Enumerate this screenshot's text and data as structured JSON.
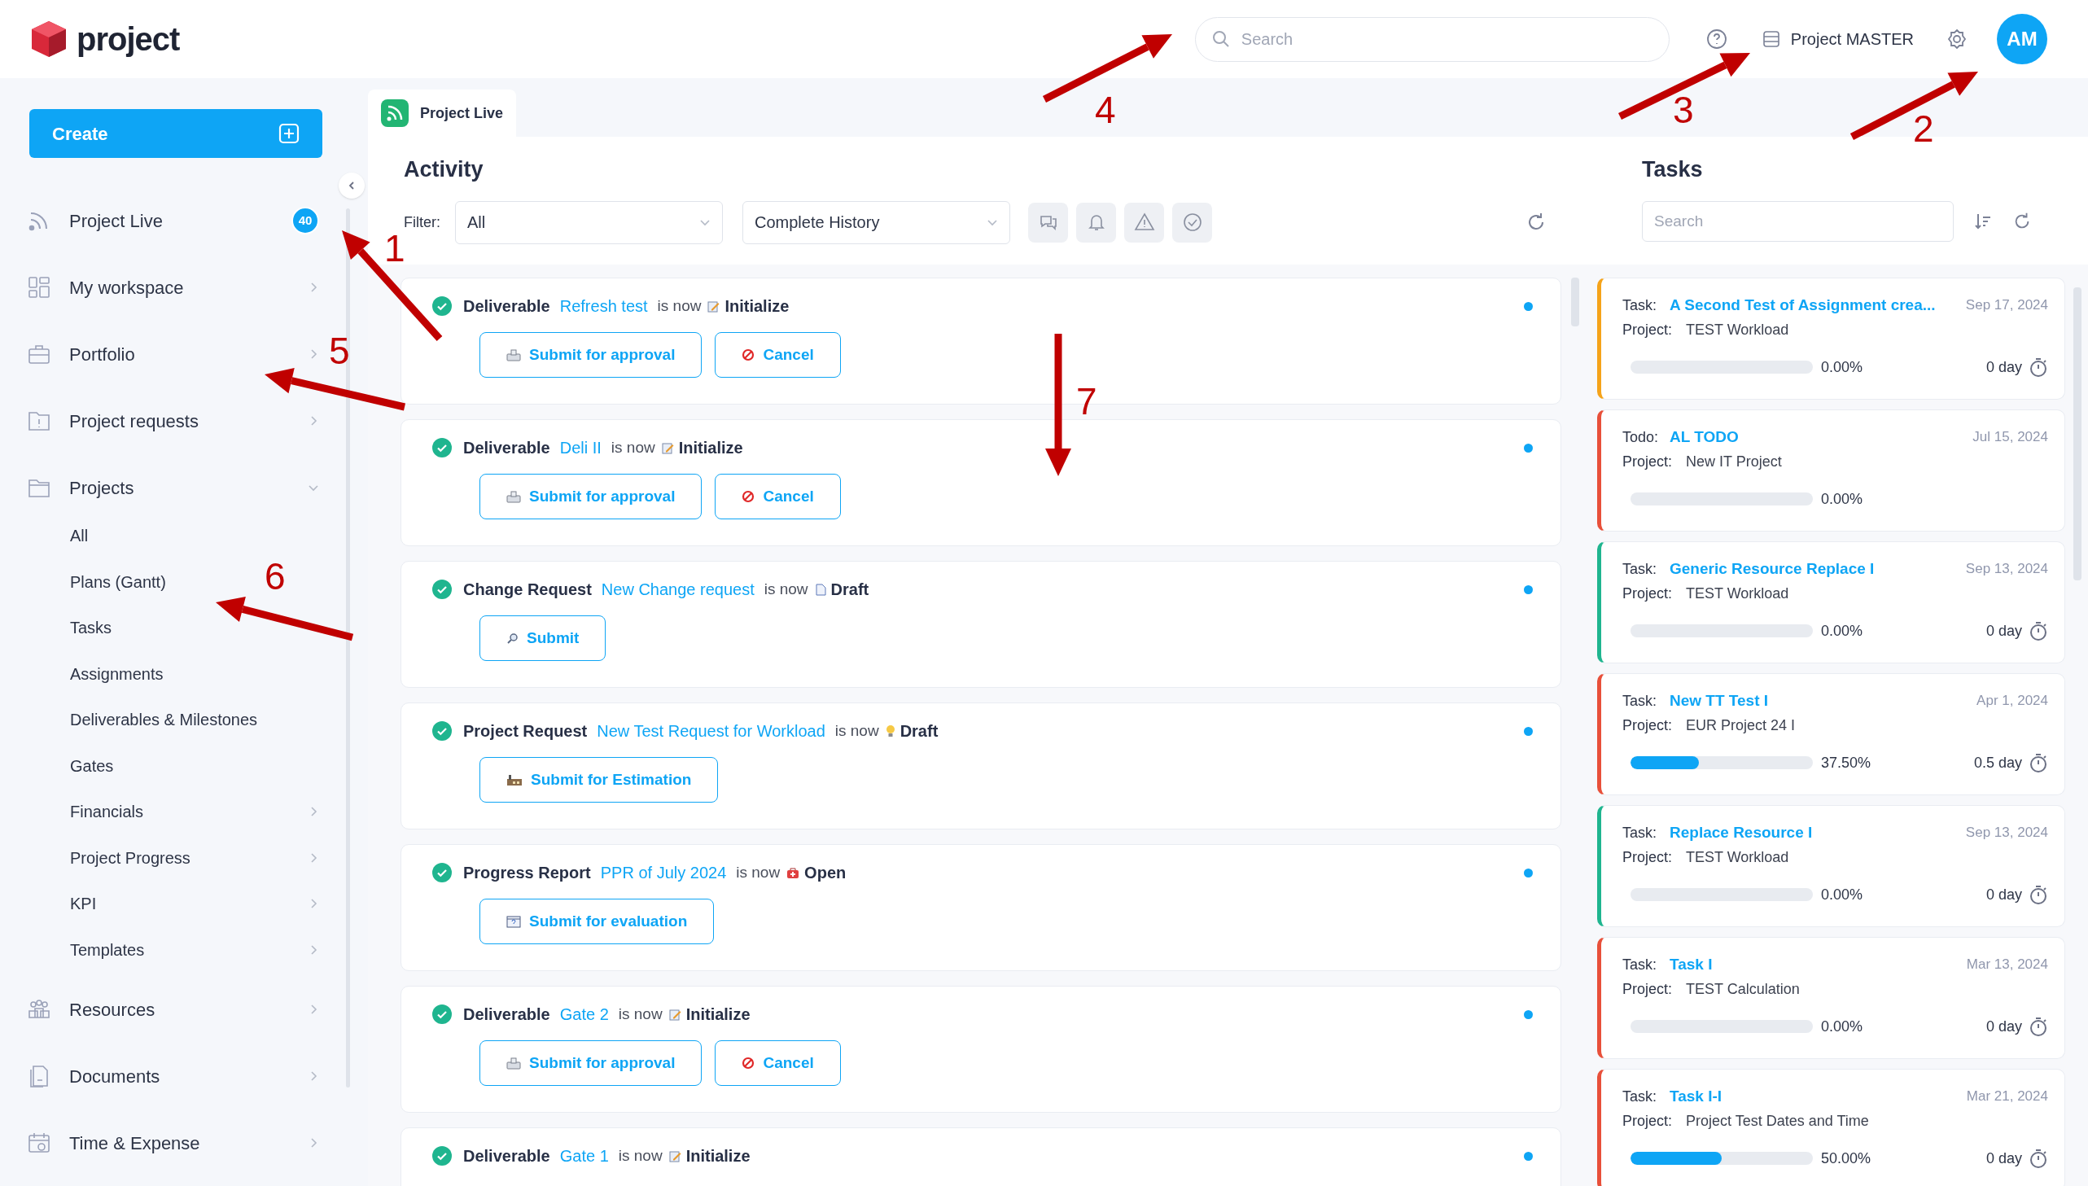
{
  "header": {
    "logo": "project",
    "search": {
      "placeholder": "Search"
    },
    "workspace": "Project MASTER",
    "avatar": "AM"
  },
  "sidebar": {
    "create": "Create",
    "items": [
      {
        "label": "Project Live",
        "badge": "40"
      },
      {
        "label": "My workspace",
        "expanded": false
      },
      {
        "label": "Portfolio",
        "expanded": false
      },
      {
        "label": "Project requests",
        "expanded": false
      },
      {
        "label": "Projects",
        "expanded": true,
        "children": [
          {
            "label": "All"
          },
          {
            "label": "Plans (Gantt)"
          },
          {
            "label": "Tasks"
          },
          {
            "label": "Assignments"
          },
          {
            "label": "Deliverables & Milestones"
          },
          {
            "label": "Gates"
          },
          {
            "label": "Financials",
            "expanded": false
          },
          {
            "label": "Project Progress",
            "expanded": false
          },
          {
            "label": "KPI",
            "expanded": false
          },
          {
            "label": "Templates",
            "expanded": false
          }
        ]
      },
      {
        "label": "Resources",
        "expanded": false
      },
      {
        "label": "Documents",
        "expanded": false
      },
      {
        "label": "Time & Expense",
        "expanded": false
      }
    ]
  },
  "tab": {
    "label": "Project Live"
  },
  "activity": {
    "title": "Activity",
    "filter_label": "Filter:",
    "filter": "All",
    "history": "Complete History",
    "items": [
      {
        "type": "Deliverable",
        "name": "Refresh test",
        "is_now": "is now",
        "status": {
          "kind": "edit",
          "label": "Initialize"
        },
        "buttons": [
          {
            "kind": "approve",
            "label": "Submit for approval"
          },
          {
            "kind": "cancel",
            "label": "Cancel"
          }
        ]
      },
      {
        "type": "Deliverable",
        "name": "Deli II",
        "is_now": "is now",
        "status": {
          "kind": "edit",
          "label": "Initialize"
        },
        "buttons": [
          {
            "kind": "approve",
            "label": "Submit for approval"
          },
          {
            "kind": "cancel",
            "label": "Cancel"
          }
        ]
      },
      {
        "type": "Change Request",
        "name": "New Change request",
        "is_now": "is now",
        "status": {
          "kind": "doc",
          "label": "Draft"
        },
        "buttons": [
          {
            "kind": "submit",
            "label": "Submit"
          }
        ]
      },
      {
        "type": "Project Request",
        "name": "New Test Request for Workload",
        "is_now": "is now",
        "status": {
          "kind": "bulb",
          "label": "Draft"
        },
        "buttons": [
          {
            "kind": "estimate",
            "label": "Submit for Estimation"
          }
        ]
      },
      {
        "type": "Progress Report",
        "name": "PPR of July 2024",
        "is_now": "is now",
        "status": {
          "kind": "open",
          "label": "Open"
        },
        "buttons": [
          {
            "kind": "evaluate",
            "label": "Submit for evaluation"
          }
        ]
      },
      {
        "type": "Deliverable",
        "name": "Gate 2",
        "is_now": "is now",
        "status": {
          "kind": "edit",
          "label": "Initialize"
        },
        "buttons": [
          {
            "kind": "approve",
            "label": "Submit for approval"
          },
          {
            "kind": "cancel",
            "label": "Cancel"
          }
        ]
      },
      {
        "type": "Deliverable",
        "name": "Gate 1",
        "is_now": "is now",
        "status": {
          "kind": "edit",
          "label": "Initialize"
        }
      }
    ]
  },
  "tasks": {
    "title": "Tasks",
    "search": {
      "placeholder": "Search"
    },
    "items": [
      {
        "type": "Task:",
        "name": "A Second Test of Assignment crea...",
        "date": "Sep 17, 2024",
        "project_label": "Project:",
        "project": "TEST Workload",
        "level": 0,
        "percent": "0.00%",
        "duration": "0 day",
        "color": "#f5a31a"
      },
      {
        "type": "Todo:",
        "name": "AL TODO",
        "date": "Jul 15, 2024",
        "project_label": "Project:",
        "project": "New IT Project",
        "level": 0,
        "percent": "0.00%",
        "color": "#e8503a"
      },
      {
        "type": "Task:",
        "name": "Generic Resource Replace I",
        "date": "Sep 13, 2024",
        "project_label": "Project:",
        "project": "TEST Workload",
        "level": 0,
        "percent": "0.00%",
        "duration": "0 day",
        "color": "#1fb58f"
      },
      {
        "type": "Task:",
        "name": "New TT Test I",
        "date": "Apr 1, 2024",
        "project_label": "Project:",
        "project": "EUR Project 24 I",
        "level": 0.375,
        "percent": "37.50%",
        "duration": "0.5 day",
        "color": "#e8503a"
      },
      {
        "type": "Task:",
        "name": "Replace Resource I",
        "date": "Sep 13, 2024",
        "project_label": "Project:",
        "project": "TEST Workload",
        "level": 0,
        "percent": "0.00%",
        "duration": "0 day",
        "color": "#1fb58f"
      },
      {
        "type": "Task:",
        "name": "Task I",
        "date": "Mar 13, 2024",
        "project_label": "Project:",
        "project": "TEST Calculation",
        "level": 0,
        "percent": "0.00%",
        "duration": "0 day",
        "color": "#e8503a"
      },
      {
        "type": "Task:",
        "name": "Task I-I",
        "date": "Mar 21, 2024",
        "project_label": "Project:",
        "project": "Project Test Dates and Time",
        "level": 0.5,
        "percent": "50.00%",
        "duration": "0 day",
        "color": "#e8503a"
      }
    ]
  },
  "annotations": [
    {
      "label": "1"
    },
    {
      "label": "2"
    },
    {
      "label": "3"
    },
    {
      "label": "4"
    },
    {
      "label": "5"
    },
    {
      "label": "6"
    },
    {
      "label": "7"
    }
  ]
}
